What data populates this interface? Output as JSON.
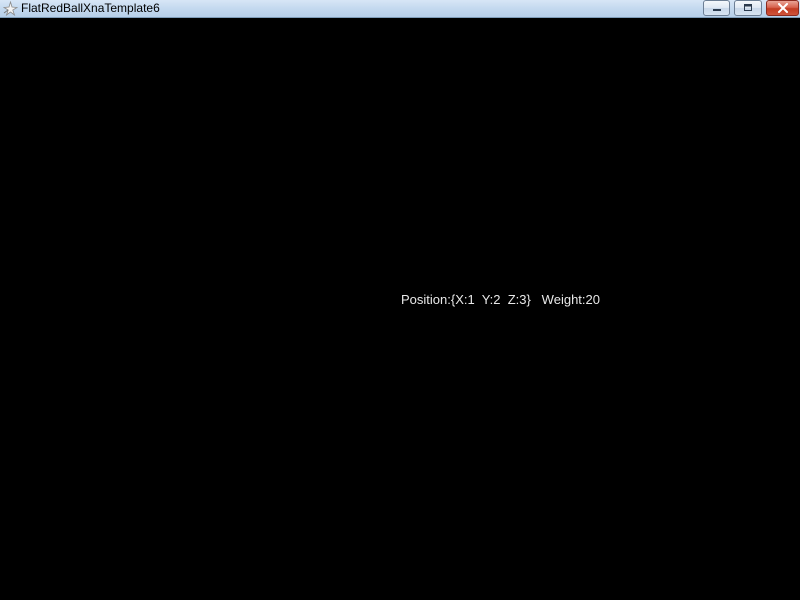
{
  "window": {
    "title": "FlatRedBallXnaTemplate6",
    "app_icon": "flatredball-star-icon",
    "caption_buttons": {
      "minimize": "minimize-icon",
      "maximize": "restore-icon",
      "close": "close-icon"
    }
  },
  "game": {
    "status_text": "Position:{X:1  Y:2  Z:3}   Weight:20"
  },
  "colors": {
    "background": "#000000",
    "text": "#e8e8e8",
    "titlebar": "#c4d9ef",
    "close_button": "#c23b22"
  }
}
